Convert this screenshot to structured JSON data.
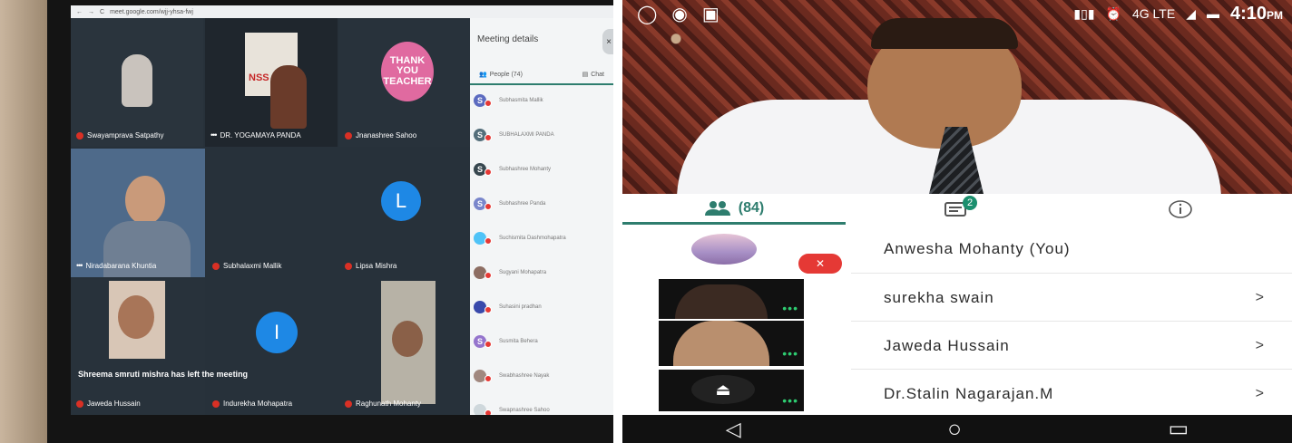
{
  "left_screen": {
    "url": "meet.google.com/wjj-yhsa-fwj",
    "tiles": [
      {
        "name": "Swayamprava Satpathy"
      },
      {
        "name": "DR. YOGAMAYA PANDA",
        "banner": "NSS D"
      },
      {
        "name": "Jnanashree Sahoo",
        "badge": "THANK YOU TEACHER"
      },
      {
        "name": "Niradabarana Khuntia"
      },
      {
        "name": "Subhalaxmi Mallik"
      },
      {
        "name": "Lipsa Mishra",
        "initial": "L"
      },
      {
        "name": "Jaweda Hussain"
      },
      {
        "name": "Indurekha Mohapatra",
        "initial": "I"
      },
      {
        "name": "Raghunath Mohanty"
      }
    ],
    "left_message": "Shreema smruti mishra has left the meeting",
    "panel": {
      "title": "Meeting details",
      "close": "×",
      "people_tab": "People (74)",
      "chat_tab": "Chat",
      "participants": [
        {
          "initial": "S",
          "name": "Subhasmita Mallik",
          "color": "#5c6bc0"
        },
        {
          "initial": "S",
          "name": "SUBHALAXMI PANDA",
          "color": "#546e7a"
        },
        {
          "initial": "S",
          "name": "Subhashree Mohanty",
          "color": "#37474f"
        },
        {
          "initial": "S",
          "name": "Subhashree Panda",
          "color": "#7986cb"
        },
        {
          "initial": "",
          "name": "Suchismita Dashmohapatra",
          "color": "#4fc3f7"
        },
        {
          "initial": "",
          "name": "Sugyani Mohapatra",
          "color": "#8d6e63"
        },
        {
          "initial": "",
          "name": "Suhasini pradhan",
          "color": "#3949ab"
        },
        {
          "initial": "S",
          "name": "Susmita Behera",
          "color": "#9575cd"
        },
        {
          "initial": "",
          "name": "Swabhashree Nayak",
          "color": "#a1887f"
        },
        {
          "initial": "",
          "name": "Swapnashree Sahoo",
          "color": "#cfd8dc"
        }
      ]
    }
  },
  "phone": {
    "status_time": "4:10",
    "status_ampm": "PM",
    "status_net": "4G LTE",
    "people_count": "(84)",
    "chat_badge": "2",
    "participants": [
      {
        "name": "Anwesha Mohanty (You)"
      },
      {
        "name": "surekha swain",
        "chev": ">"
      },
      {
        "name": "Jaweda Hussain",
        "chev": ">"
      },
      {
        "name": "Dr.Stalin Nagarajan.M",
        "chev": ">"
      }
    ],
    "nav": {
      "back": "◁",
      "home": "○",
      "recent": "▭"
    }
  }
}
